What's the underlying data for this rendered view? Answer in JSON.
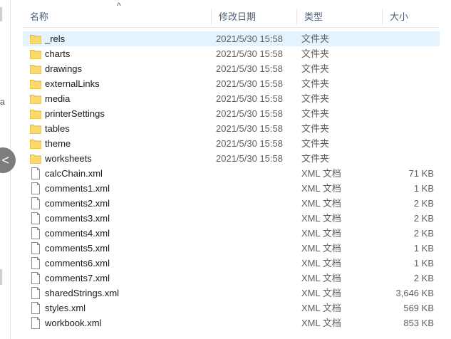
{
  "header": {
    "sort_indicator": "^",
    "columns": [
      {
        "label": "名称"
      },
      {
        "label": "修改日期"
      },
      {
        "label": "类型"
      },
      {
        "label": "大小"
      }
    ]
  },
  "left_fragment": "a",
  "nav_button_glyph": "<",
  "files": [
    {
      "name": "_rels",
      "date": "2021/5/30 15:58",
      "type": "文件夹",
      "size": "",
      "icon": "folder-icon",
      "selected": true
    },
    {
      "name": "charts",
      "date": "2021/5/30 15:58",
      "type": "文件夹",
      "size": "",
      "icon": "folder-icon"
    },
    {
      "name": "drawings",
      "date": "2021/5/30 15:58",
      "type": "文件夹",
      "size": "",
      "icon": "folder-icon"
    },
    {
      "name": "externalLinks",
      "date": "2021/5/30 15:58",
      "type": "文件夹",
      "size": "",
      "icon": "folder-icon"
    },
    {
      "name": "media",
      "date": "2021/5/30 15:58",
      "type": "文件夹",
      "size": "",
      "icon": "folder-icon"
    },
    {
      "name": "printerSettings",
      "date": "2021/5/30 15:58",
      "type": "文件夹",
      "size": "",
      "icon": "folder-icon"
    },
    {
      "name": "tables",
      "date": "2021/5/30 15:58",
      "type": "文件夹",
      "size": "",
      "icon": "folder-icon"
    },
    {
      "name": "theme",
      "date": "2021/5/30 15:58",
      "type": "文件夹",
      "size": "",
      "icon": "folder-icon"
    },
    {
      "name": "worksheets",
      "date": "2021/5/30 15:58",
      "type": "文件夹",
      "size": "",
      "icon": "folder-icon"
    },
    {
      "name": "calcChain.xml",
      "date": "",
      "type": "XML 文档",
      "size": "71 KB",
      "icon": "file-icon"
    },
    {
      "name": "comments1.xml",
      "date": "",
      "type": "XML 文档",
      "size": "1 KB",
      "icon": "file-icon"
    },
    {
      "name": "comments2.xml",
      "date": "",
      "type": "XML 文档",
      "size": "2 KB",
      "icon": "file-icon"
    },
    {
      "name": "comments3.xml",
      "date": "",
      "type": "XML 文档",
      "size": "2 KB",
      "icon": "file-icon"
    },
    {
      "name": "comments4.xml",
      "date": "",
      "type": "XML 文档",
      "size": "2 KB",
      "icon": "file-icon"
    },
    {
      "name": "comments5.xml",
      "date": "",
      "type": "XML 文档",
      "size": "1 KB",
      "icon": "file-icon"
    },
    {
      "name": "comments6.xml",
      "date": "",
      "type": "XML 文档",
      "size": "1 KB",
      "icon": "file-icon"
    },
    {
      "name": "comments7.xml",
      "date": "",
      "type": "XML 文档",
      "size": "2 KB",
      "icon": "file-icon"
    },
    {
      "name": "sharedStrings.xml",
      "date": "",
      "type": "XML 文档",
      "size": "3,646 KB",
      "icon": "file-icon"
    },
    {
      "name": "styles.xml",
      "date": "",
      "type": "XML 文档",
      "size": "569 KB",
      "icon": "file-icon"
    },
    {
      "name": "workbook.xml",
      "date": "",
      "type": "XML 文档",
      "size": "853 KB",
      "icon": "file-icon"
    }
  ],
  "colors": {
    "selection": "#e5f3ff",
    "folder": "#f8d775",
    "header_text": "#4c607a"
  }
}
